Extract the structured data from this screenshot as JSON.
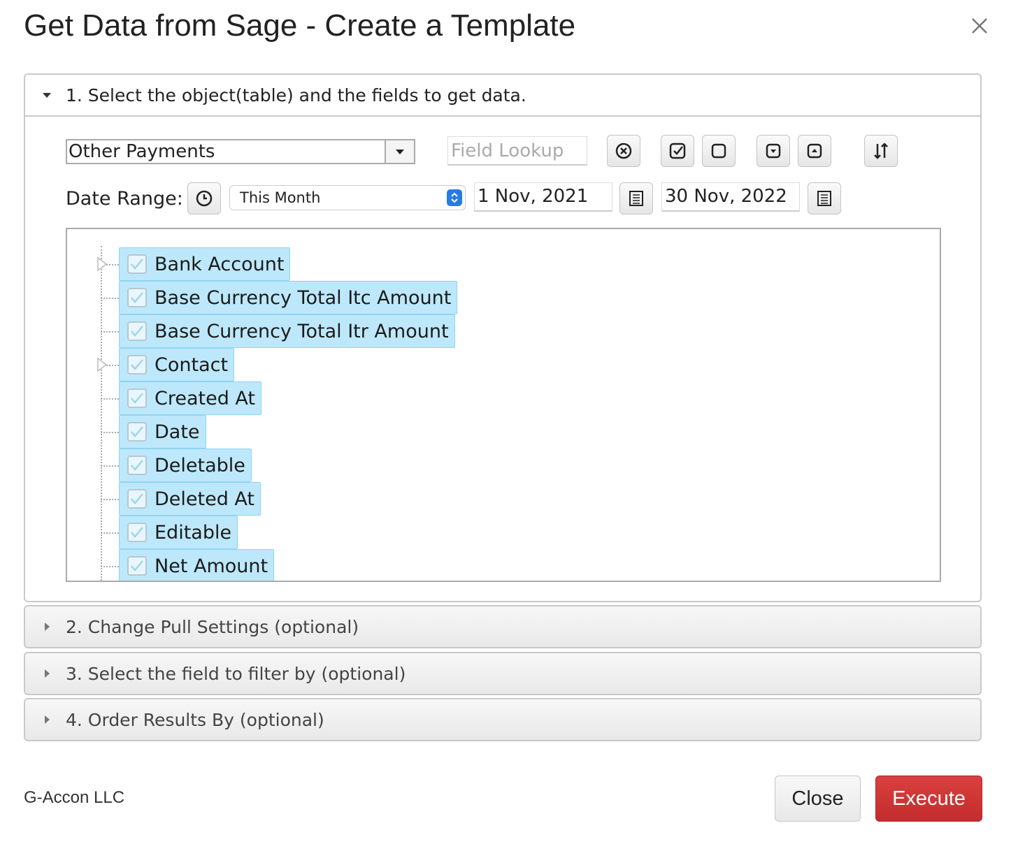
{
  "dialog": {
    "title": "Get Data from Sage - Create a Template",
    "close_icon": "close-icon"
  },
  "sections": {
    "s1": {
      "label": "1. Select the object(table) and the fields to get data.",
      "expanded": true
    },
    "s2": {
      "label": "2. Change Pull Settings (optional)",
      "expanded": false
    },
    "s3": {
      "label": "3. Select the field to filter by (optional)",
      "expanded": false
    },
    "s4": {
      "label": "4. Order Results By (optional)",
      "expanded": false
    }
  },
  "object_select": {
    "value": "Other Payments"
  },
  "field_lookup": {
    "placeholder": "Field Lookup"
  },
  "toolbar_icons": [
    "clear-icon",
    "check-all-icon",
    "uncheck-all-icon",
    "collapse-icon",
    "expand-icon",
    "sort-icon"
  ],
  "date_range": {
    "label": "Date Range:",
    "preset": "This Month",
    "start": "1 Nov, 2021",
    "end": "30 Nov, 2022"
  },
  "fields": [
    {
      "label": "Bank Account",
      "checked": true,
      "expandable": true
    },
    {
      "label": "Base Currency Total Itc Amount",
      "checked": true,
      "expandable": false
    },
    {
      "label": "Base Currency Total Itr Amount",
      "checked": true,
      "expandable": false
    },
    {
      "label": "Contact",
      "checked": true,
      "expandable": true
    },
    {
      "label": "Created At",
      "checked": true,
      "expandable": false
    },
    {
      "label": "Date",
      "checked": true,
      "expandable": false
    },
    {
      "label": "Deletable",
      "checked": true,
      "expandable": false
    },
    {
      "label": "Deleted At",
      "checked": true,
      "expandable": false
    },
    {
      "label": "Editable",
      "checked": true,
      "expandable": false
    },
    {
      "label": "Net Amount",
      "checked": true,
      "expandable": false
    }
  ],
  "footer": {
    "company": "G-Accon LLC",
    "close_label": "Close",
    "execute_label": "Execute"
  },
  "colors": {
    "accent": "#2a7ae2",
    "selection": "#bde8fb",
    "execute": "#c9302c"
  }
}
